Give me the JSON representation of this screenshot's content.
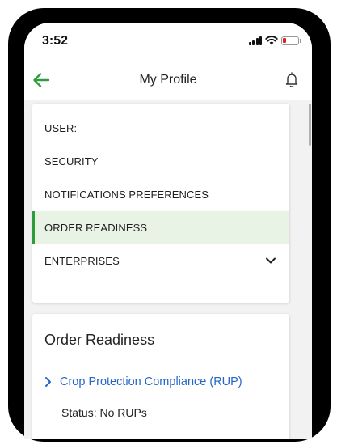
{
  "status_bar": {
    "time": "3:52"
  },
  "header": {
    "title": "My Profile"
  },
  "menu": {
    "items": [
      {
        "label": "USER:"
      },
      {
        "label": "SECURITY"
      },
      {
        "label": "NOTIFICATIONS PREFERENCES"
      },
      {
        "label": "ORDER READINESS"
      },
      {
        "label": "ENTERPRISES"
      }
    ],
    "active_index": 3
  },
  "order_readiness": {
    "title": "Order Readiness",
    "link_label": "Crop Protection Compliance (RUP)",
    "status": "Status: No RUPs"
  },
  "colors": {
    "accent_green": "#2f9c3a",
    "active_bg": "#e8f3e5",
    "link_blue": "#2566c7",
    "battery_low": "#e02020"
  },
  "icons": [
    "back-arrow-icon",
    "bell-icon",
    "chevron-down-icon",
    "chevron-right-icon",
    "signal-icon",
    "wifi-icon",
    "battery-icon"
  ]
}
